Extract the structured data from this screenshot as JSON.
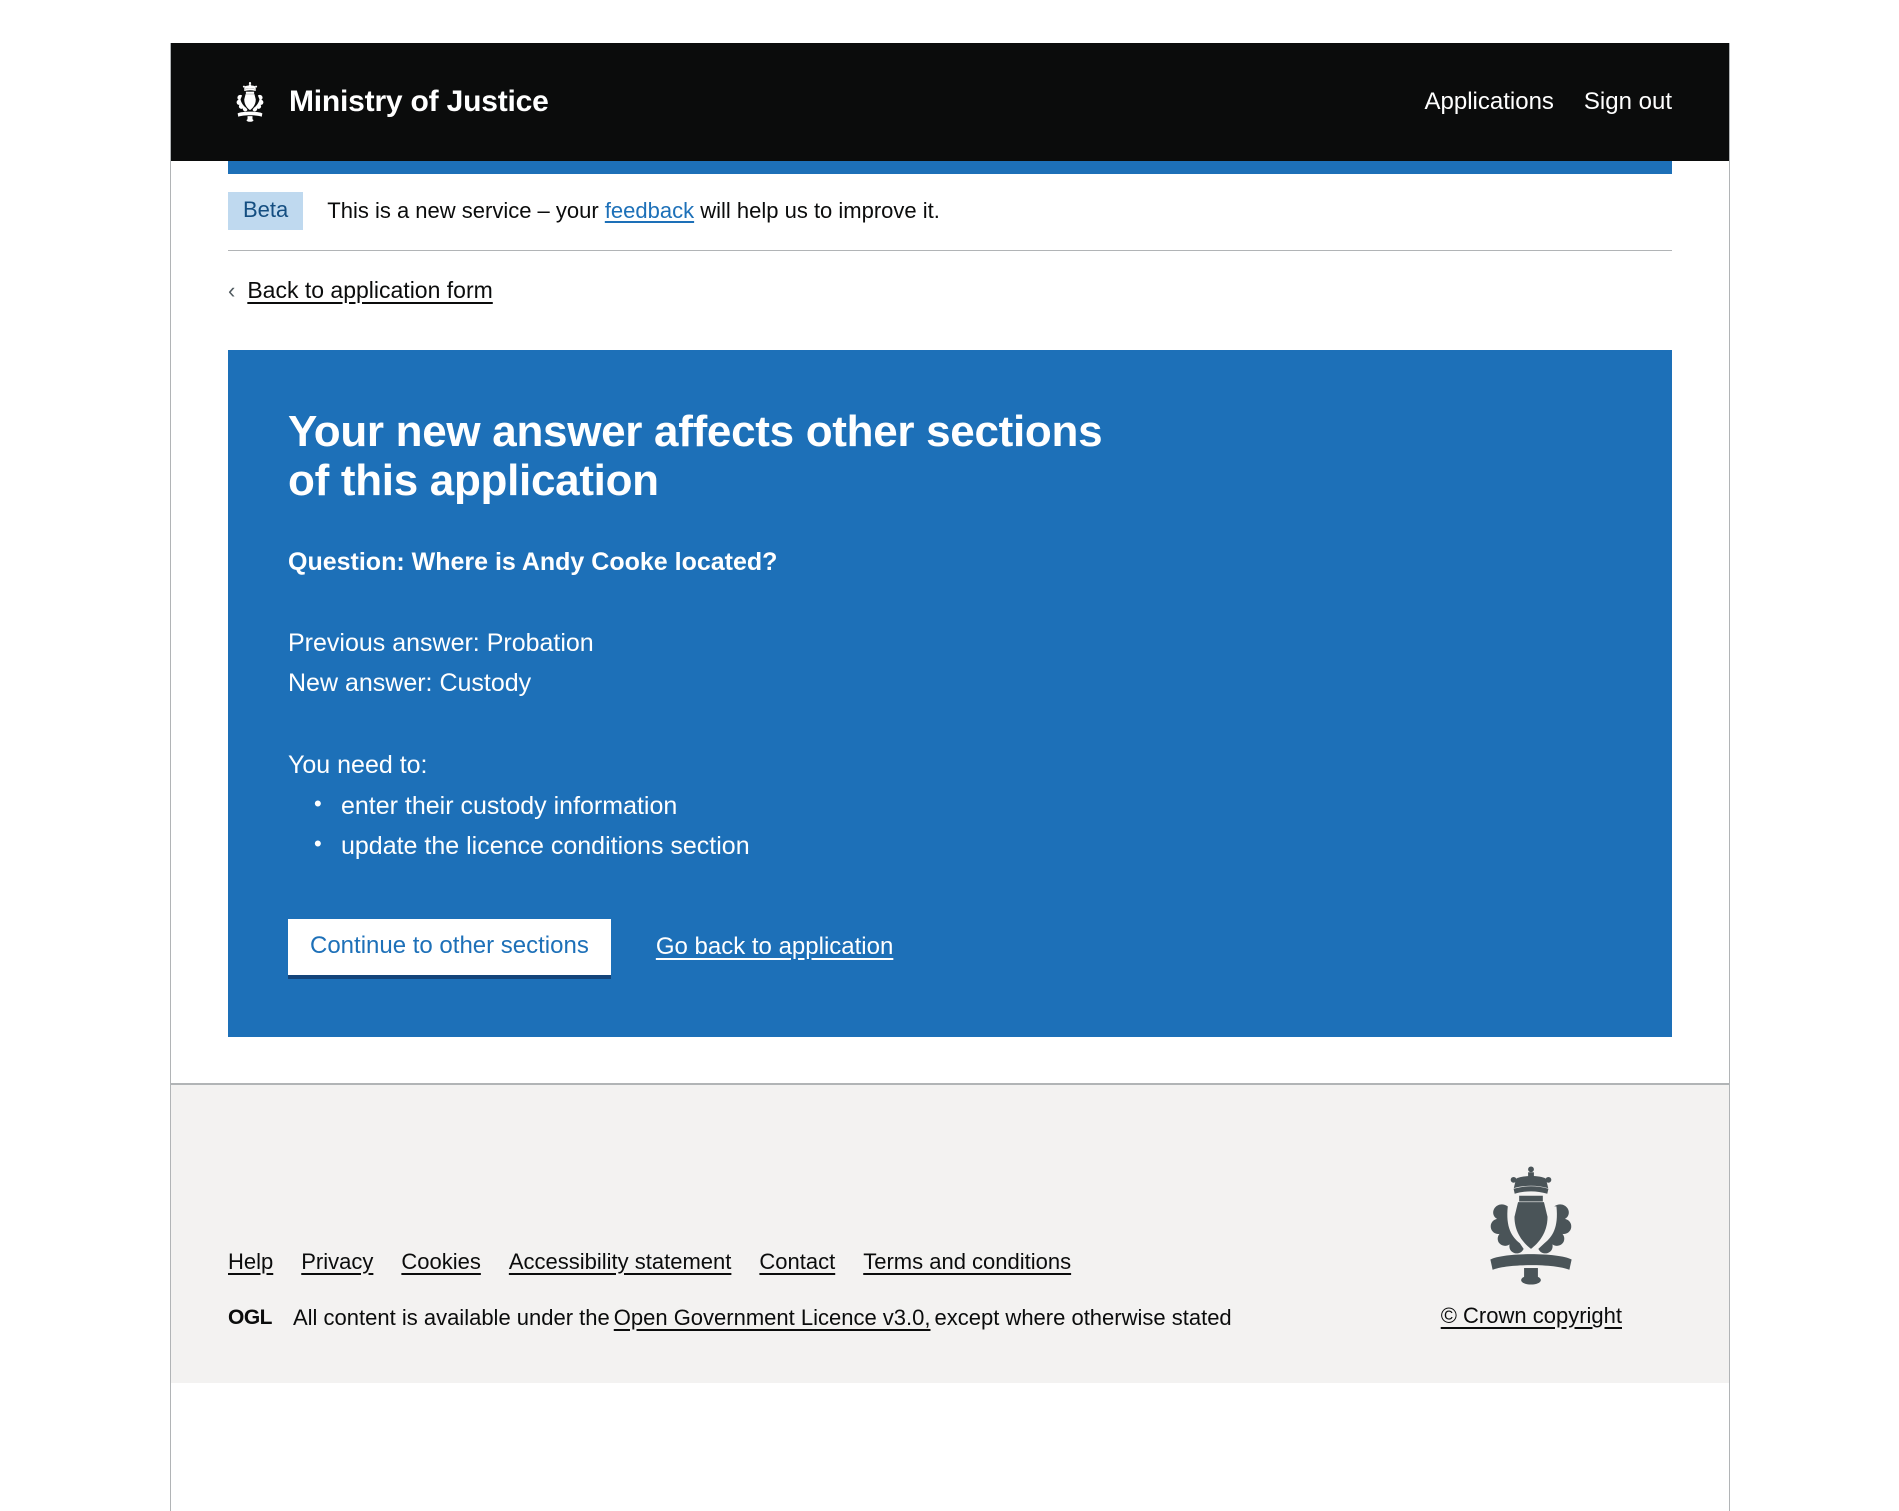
{
  "header": {
    "brand_title": "Ministry of Justice",
    "crest_icon": "royal-crest-icon",
    "nav": [
      {
        "label": "Applications"
      },
      {
        "label": "Sign out"
      }
    ]
  },
  "phase_banner": {
    "tag": "Beta",
    "text_before": "This is a new service – your ",
    "link": "feedback",
    "text_after": " will help us to improve it."
  },
  "back_link": {
    "chevron_icon": "chevron-left-icon",
    "label": "Back to application form"
  },
  "panel": {
    "heading": "Your new answer affects other sections of this application",
    "question": "Question: Where is Andy Cooke located?",
    "previous_answer": "Previous answer: Probation",
    "new_answer": "New answer: Custody",
    "need_to_label": "You need to:",
    "need_to_items": [
      "enter their custody information",
      "update the licence conditions section"
    ],
    "primary_button": "Continue to other sections",
    "secondary_link": "Go back to application",
    "background_color": "#1d70b8",
    "text_color": "#ffffff"
  },
  "footer": {
    "links": [
      {
        "label": "Help"
      },
      {
        "label": "Privacy"
      },
      {
        "label": "Cookies"
      },
      {
        "label": "Accessibility statement"
      },
      {
        "label": "Contact"
      },
      {
        "label": "Terms and conditions"
      }
    ],
    "ogl_logo": "OGL",
    "licence_text_before": "All content is available under the ",
    "licence_link": "Open Government Licence v3.0,",
    "licence_text_after": " except where otherwise stated",
    "crest_icon": "royal-crest-icon",
    "crown_copyright": "© Crown copyright"
  }
}
